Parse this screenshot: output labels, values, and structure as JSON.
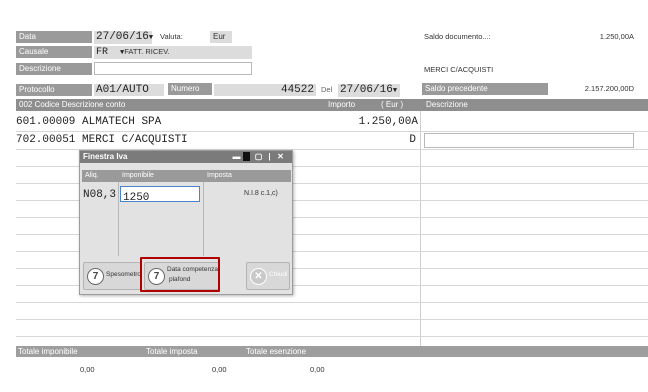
{
  "header": {
    "data_label": "Data",
    "data_value": "27/06/16",
    "valuta_label": "Valuta:",
    "valuta_value": "Eur",
    "causale_label": "Causale",
    "causale_code": "FR",
    "causale_desc": "FATT. RICEV.",
    "descrizione_label": "Descrizione",
    "descrizione_value": "",
    "protocollo_label": "Protocollo",
    "protocollo_value": "A01/AUTO",
    "numero_label": "Numero",
    "numero_value": "44522",
    "del_label": "Del",
    "del_value": "27/06/16"
  },
  "right_panel": {
    "saldo_documento_label": "Saldo documento...:",
    "saldo_documento_value": "1.250,00A",
    "account_name": "MERCI C/ACQUISTI",
    "saldo_precedente_label": "Saldo precedente",
    "saldo_precedente_value": "2.157.200,00D"
  },
  "grid": {
    "col_code": "002   Codice Descrizione conto",
    "col_importo": "Importo",
    "col_currency": "( Eur )",
    "col_descrizione": "Descrizione",
    "rows": [
      {
        "code": "601.00009",
        "name": "ALMATECH SPA",
        "amount": "1.250,00A"
      },
      {
        "code": "702.00051",
        "name": "MERCI C/ACQUISTI",
        "amount": "D"
      }
    ]
  },
  "dialog": {
    "title": "Finestra Iva",
    "col_aliq": "Aliq.",
    "col_imponibile": "Imponibile",
    "col_imposta": "Imposta",
    "row_aliq": "N08,3",
    "row_imponibile": "1250",
    "row_imposta": "N.I.8 c.1,c)",
    "btn_spesometro_key": "7",
    "btn_spesometro_label": "Spesometro",
    "btn_competenza_key": "7",
    "btn_competenza_label_1": "Data competenza",
    "btn_competenza_label_2": "plafond",
    "btn_chiudi_label": "Chiudi",
    "highlight_color": "#b00000"
  },
  "footer": {
    "totale_imponibile_label": "Totale imponibile",
    "totale_imposta_label": "Totale imposta",
    "totale_esenzione_label": "Totale esenzione",
    "totale_imponibile_value": "0,00",
    "totale_imposta_value": "0,00",
    "totale_esenzione_value": "0,00"
  }
}
